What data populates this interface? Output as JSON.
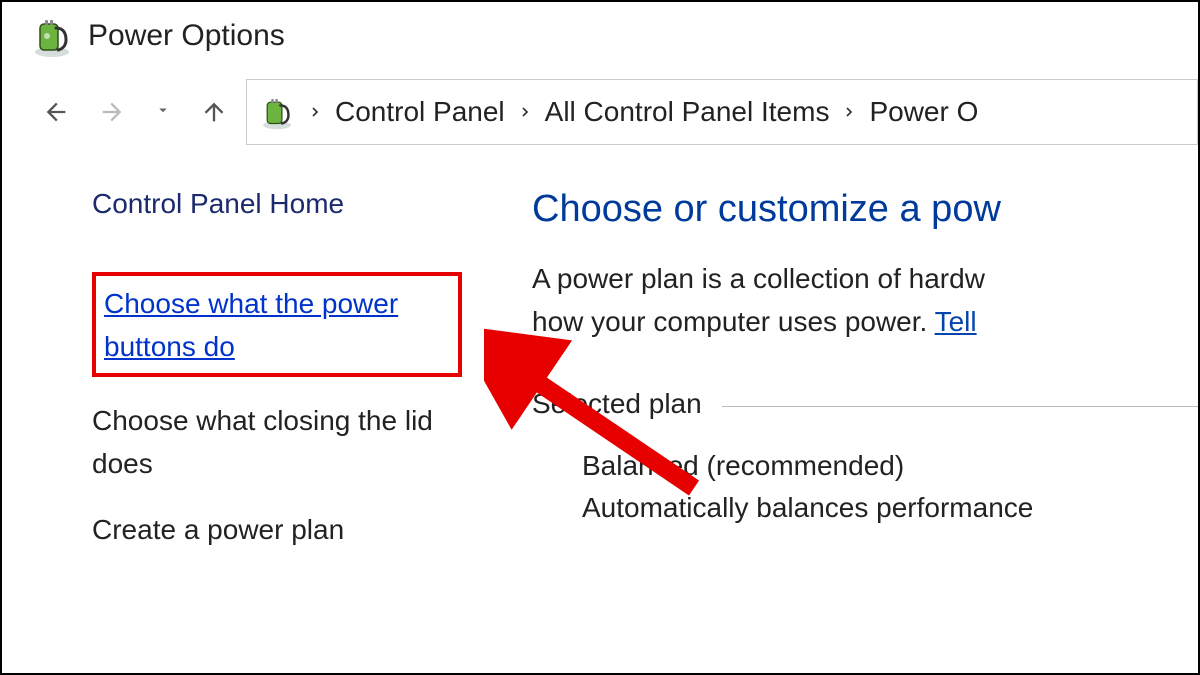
{
  "window": {
    "title": "Power Options"
  },
  "breadcrumb": {
    "items": [
      "Control Panel",
      "All Control Panel Items",
      "Power O"
    ]
  },
  "sidebar": {
    "home": "Control Panel Home",
    "links": [
      "Choose what the power buttons do",
      "Choose what closing the lid does",
      "Create a power plan"
    ]
  },
  "main": {
    "heading": "Choose or customize a pow",
    "desc1": "A power plan is a collection of hardw",
    "desc2": "how your computer uses power. ",
    "tell_link": "Tell ",
    "selected_plan_label": "Selected plan",
    "plan_name": "Balanced (recommended)",
    "plan_desc": "Automatically balances performance"
  }
}
